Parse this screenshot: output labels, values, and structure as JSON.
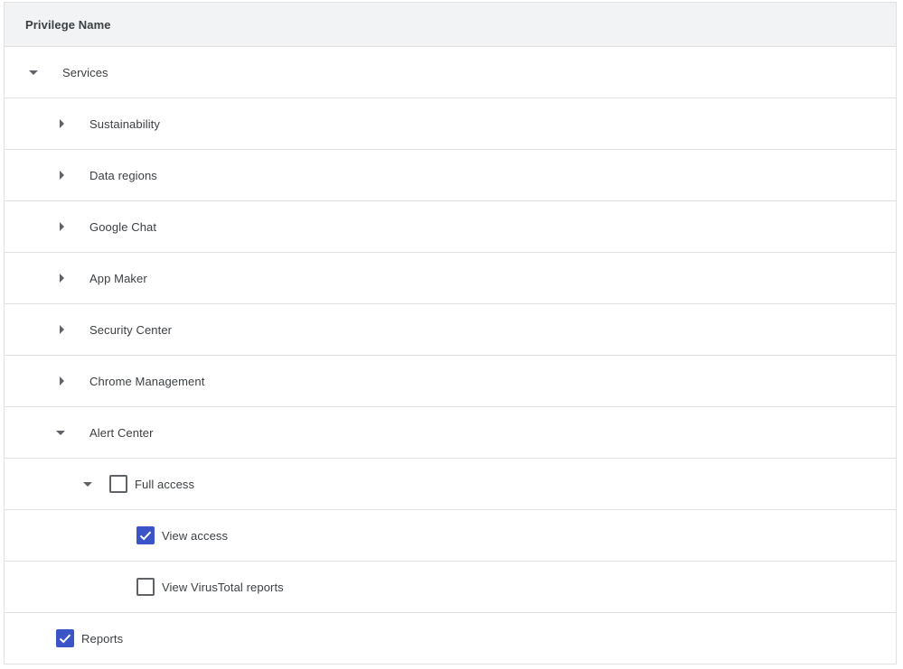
{
  "table": {
    "header": "Privilege Name",
    "rows": [
      {
        "label": "Services",
        "expanded": true
      },
      {
        "label": "Sustainability",
        "expanded": false
      },
      {
        "label": "Data regions",
        "expanded": false
      },
      {
        "label": "Google Chat",
        "expanded": false
      },
      {
        "label": "App Maker",
        "expanded": false
      },
      {
        "label": "Security Center",
        "expanded": false
      },
      {
        "label": "Chrome Management",
        "expanded": false
      },
      {
        "label": "Alert Center",
        "expanded": true
      },
      {
        "label": "Full access",
        "expanded": true,
        "checked": false
      },
      {
        "label": "View access",
        "checked": true
      },
      {
        "label": "View VirusTotal reports",
        "checked": false
      },
      {
        "label": "Reports",
        "checked": true
      }
    ]
  },
  "colors": {
    "checkbox_checked": "#3b55c9",
    "header_bg": "#f1f3f4",
    "divider": "#e0e0e0"
  },
  "icons": {
    "expanded": "chevron-down-icon",
    "collapsed": "chevron-right-icon",
    "check": "check-icon"
  }
}
